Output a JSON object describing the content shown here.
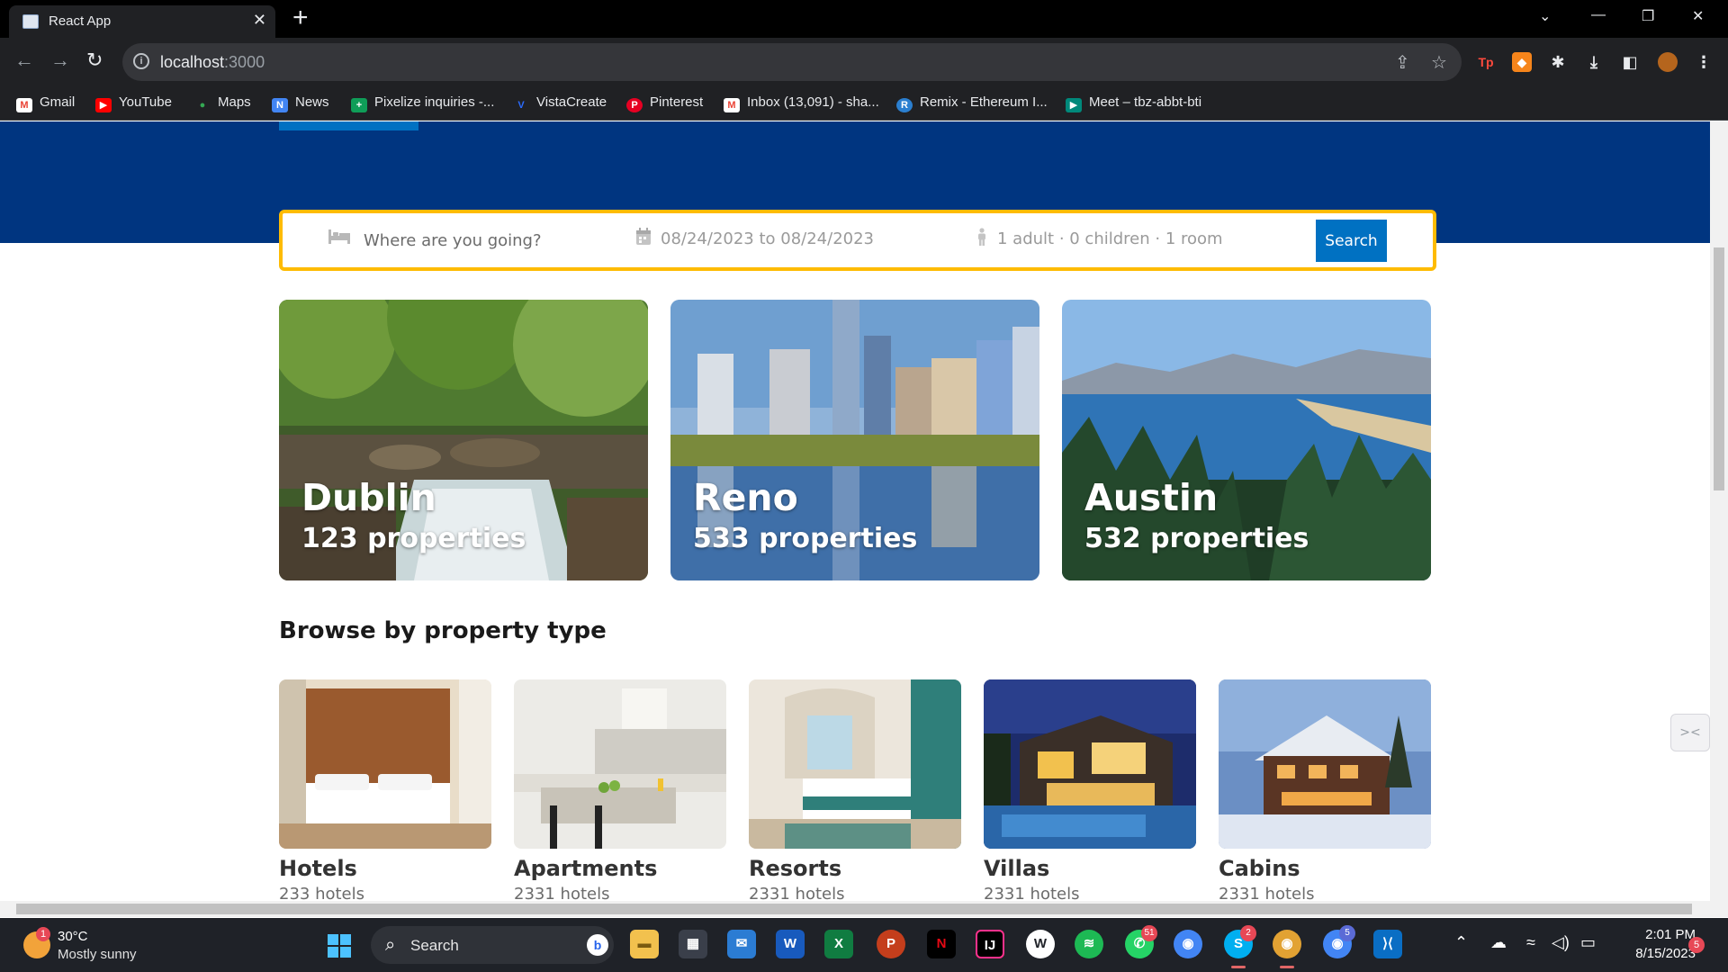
{
  "browser": {
    "tab_title": "React App",
    "url_host": "localhost",
    "url_port": ":3000",
    "bookmarks": [
      {
        "label": "Gmail",
        "icon": "gmail-icon",
        "color": "#ea4335",
        "glyph": "M"
      },
      {
        "label": "YouTube",
        "icon": "youtube-icon",
        "color": "#ff0000",
        "glyph": "▶"
      },
      {
        "label": "Maps",
        "icon": "maps-icon",
        "color": "#34a853",
        "glyph": "●"
      },
      {
        "label": "News",
        "icon": "news-icon",
        "color": "#4285f4",
        "glyph": "N"
      },
      {
        "label": "Pixelize inquiries -...",
        "icon": "sheets-icon",
        "color": "#0f9d58",
        "glyph": "+"
      },
      {
        "label": "VistaCreate",
        "icon": "vistacreate-icon",
        "color": "#2b6cff",
        "glyph": "V"
      },
      {
        "label": "Pinterest",
        "icon": "pinterest-icon",
        "color": "#e60023",
        "glyph": "P"
      },
      {
        "label": "Inbox (13,091) - sha...",
        "icon": "gmail-icon",
        "color": "#ea4335",
        "glyph": "M"
      },
      {
        "label": "Remix - Ethereum I...",
        "icon": "remix-icon",
        "color": "#2b7fd0",
        "glyph": "R"
      },
      {
        "label": "Meet – tbz-abbt-bti",
        "icon": "meet-icon",
        "color": "#00897b",
        "glyph": "▶"
      }
    ]
  },
  "search": {
    "destination_placeholder": "Where are you going?",
    "dates": "08/24/2023 to 08/24/2023",
    "guests": "1 adult · 0 children · 1 room",
    "button_label": "Search"
  },
  "featured": [
    {
      "city": "Dublin",
      "properties": "123 properties"
    },
    {
      "city": "Reno",
      "properties": "533 properties"
    },
    {
      "city": "Austin",
      "properties": "532 properties"
    }
  ],
  "property_types": {
    "title": "Browse by property type",
    "items": [
      {
        "name": "Hotels",
        "count": "233 hotels"
      },
      {
        "name": "Apartments",
        "count": "2331 hotels"
      },
      {
        "name": "Resorts",
        "count": "2331 hotels"
      },
      {
        "name": "Villas",
        "count": "2331 hotels"
      },
      {
        "name": "Cabins",
        "count": "2331 hotels"
      }
    ]
  },
  "taskbar": {
    "weather_temp": "30°C",
    "weather_desc": "Mostly sunny",
    "weather_badge": "1",
    "search_label": "Search",
    "whatsapp_badge": "51",
    "skype_badge": "2",
    "chrome_badge": "5",
    "time": "2:01 PM",
    "date": "8/15/2023",
    "notifications": "5"
  },
  "colors": {
    "header": "#003580",
    "search_border": "#febb02",
    "search_button": "#0071c2"
  }
}
